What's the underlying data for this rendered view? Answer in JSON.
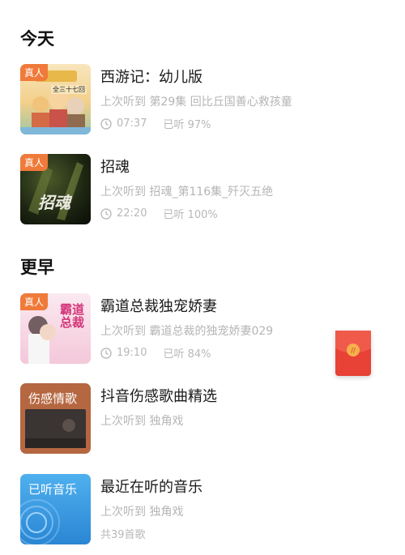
{
  "sections": {
    "today": "今天",
    "earlier": "更早"
  },
  "items": [
    {
      "tag": "真人",
      "title": "西游记：幼儿版",
      "subtitle": "上次听到 第29集 回比丘国善心救孩童",
      "time": "07:37",
      "progress": "已听 97%",
      "cover_colors": [
        "#f7d9a2",
        "#c85a3a"
      ],
      "cover_text": "全三十七回"
    },
    {
      "tag": "真人",
      "title": "招魂",
      "subtitle": "上次听到 招魂_第116集_歼灭五绝",
      "time": "22:20",
      "progress": "已听 100%",
      "cover_colors": [
        "#2f3a1e",
        "#0f1208"
      ],
      "cover_text": "招魂"
    },
    {
      "tag": "真人",
      "title": "霸道总裁独宠娇妻",
      "subtitle": "上次听到 霸道总裁的独宠娇妻029",
      "time": "19:10",
      "progress": "已听 84%",
      "cover_colors": [
        "#f6dbe6",
        "#e7a6c7"
      ],
      "cover_text": "霸道总裁"
    },
    {
      "cover_label": "伤感情歌",
      "title": "抖音伤感歌曲精选",
      "subtitle": "上次听到 独角戏",
      "cover_colors": [
        "#b86a44",
        "#a65a3b"
      ]
    },
    {
      "cover_label": "已听音乐",
      "title": "最近在听的音乐",
      "subtitle": "上次听到 独角戏",
      "count": "共39首歌",
      "cover_colors": [
        "#3ea0e6",
        "#1f7bc7"
      ]
    }
  ],
  "floating": {
    "icon": "red-envelope-icon",
    "color": "#e84135"
  }
}
